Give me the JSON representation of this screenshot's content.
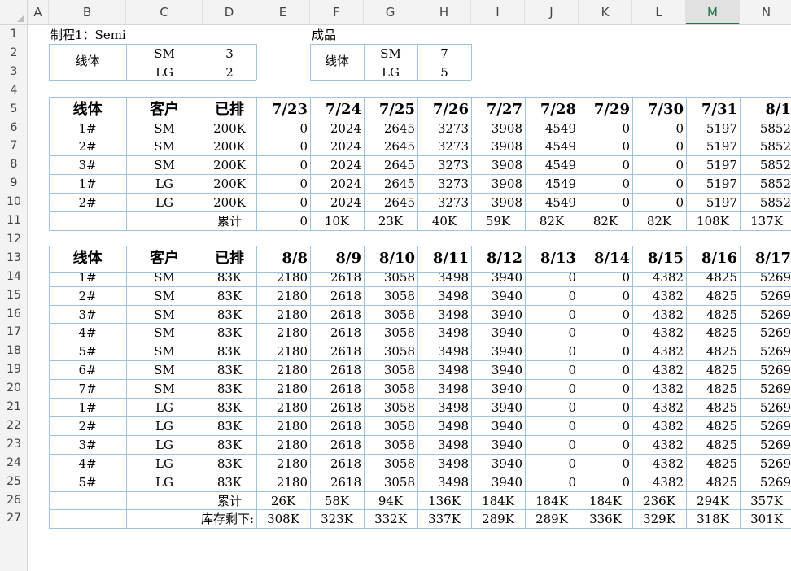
{
  "columns": [
    "A",
    "B",
    "C",
    "D",
    "E",
    "F",
    "G",
    "H",
    "I",
    "J",
    "K",
    "L",
    "M",
    "N"
  ],
  "rows": [
    "1",
    "2",
    "3",
    "4",
    "5",
    "6",
    "7",
    "8",
    "9",
    "10",
    "11",
    "12",
    "13",
    "14",
    "15",
    "16",
    "17",
    "18",
    "19",
    "20",
    "21",
    "22",
    "23",
    "24",
    "25",
    "26",
    "27"
  ],
  "top": {
    "process_label": "制程1：Semi",
    "finished_label": "成品",
    "line_label": "线体",
    "sm": "SM",
    "lg": "LG",
    "semi_sm": "3",
    "semi_lg": "2",
    "fin_sm": "7",
    "fin_lg": "5"
  },
  "table1": {
    "headers": [
      "线体",
      "客户",
      "已排",
      "7/23",
      "7/24",
      "7/25",
      "7/26",
      "7/27",
      "7/28",
      "7/29",
      "7/30",
      "7/31",
      "8/1"
    ],
    "rows": [
      [
        "1#",
        "SM",
        "200K",
        "0",
        "2024",
        "2645",
        "3273",
        "3908",
        "4549",
        "0",
        "0",
        "5197",
        "5852"
      ],
      [
        "2#",
        "SM",
        "200K",
        "0",
        "2024",
        "2645",
        "3273",
        "3908",
        "4549",
        "0",
        "0",
        "5197",
        "5852"
      ],
      [
        "3#",
        "SM",
        "200K",
        "0",
        "2024",
        "2645",
        "3273",
        "3908",
        "4549",
        "0",
        "0",
        "5197",
        "5852"
      ],
      [
        "1#",
        "LG",
        "200K",
        "0",
        "2024",
        "2645",
        "3273",
        "3908",
        "4549",
        "0",
        "0",
        "5197",
        "5852"
      ],
      [
        "2#",
        "LG",
        "200K",
        "0",
        "2024",
        "2645",
        "3273",
        "3908",
        "4549",
        "0",
        "0",
        "5197",
        "5852"
      ]
    ],
    "cumulative_label": "累计",
    "cumulative": [
      "0",
      "10K",
      "23K",
      "40K",
      "59K",
      "82K",
      "82K",
      "82K",
      "108K",
      "137K"
    ]
  },
  "table2": {
    "headers": [
      "线体",
      "客户",
      "已排",
      "8/8",
      "8/9",
      "8/10",
      "8/11",
      "8/12",
      "8/13",
      "8/14",
      "8/15",
      "8/16",
      "8/17"
    ],
    "rows": [
      [
        "1#",
        "SM",
        "83K",
        "2180",
        "2618",
        "3058",
        "3498",
        "3940",
        "0",
        "0",
        "4382",
        "4825",
        "5269"
      ],
      [
        "2#",
        "SM",
        "83K",
        "2180",
        "2618",
        "3058",
        "3498",
        "3940",
        "0",
        "0",
        "4382",
        "4825",
        "5269"
      ],
      [
        "3#",
        "SM",
        "83K",
        "2180",
        "2618",
        "3058",
        "3498",
        "3940",
        "0",
        "0",
        "4382",
        "4825",
        "5269"
      ],
      [
        "4#",
        "SM",
        "83K",
        "2180",
        "2618",
        "3058",
        "3498",
        "3940",
        "0",
        "0",
        "4382",
        "4825",
        "5269"
      ],
      [
        "5#",
        "SM",
        "83K",
        "2180",
        "2618",
        "3058",
        "3498",
        "3940",
        "0",
        "0",
        "4382",
        "4825",
        "5269"
      ],
      [
        "6#",
        "SM",
        "83K",
        "2180",
        "2618",
        "3058",
        "3498",
        "3940",
        "0",
        "0",
        "4382",
        "4825",
        "5269"
      ],
      [
        "7#",
        "SM",
        "83K",
        "2180",
        "2618",
        "3058",
        "3498",
        "3940",
        "0",
        "0",
        "4382",
        "4825",
        "5269"
      ],
      [
        "1#",
        "LG",
        "83K",
        "2180",
        "2618",
        "3058",
        "3498",
        "3940",
        "0",
        "0",
        "4382",
        "4825",
        "5269"
      ],
      [
        "2#",
        "LG",
        "83K",
        "2180",
        "2618",
        "3058",
        "3498",
        "3940",
        "0",
        "0",
        "4382",
        "4825",
        "5269"
      ],
      [
        "3#",
        "LG",
        "83K",
        "2180",
        "2618",
        "3058",
        "3498",
        "3940",
        "0",
        "0",
        "4382",
        "4825",
        "5269"
      ],
      [
        "4#",
        "LG",
        "83K",
        "2180",
        "2618",
        "3058",
        "3498",
        "3940",
        "0",
        "0",
        "4382",
        "4825",
        "5269"
      ],
      [
        "5#",
        "LG",
        "83K",
        "2180",
        "2618",
        "3058",
        "3498",
        "3940",
        "0",
        "0",
        "4382",
        "4825",
        "5269"
      ]
    ],
    "cumulative_label": "累计",
    "cumulative": [
      "26K",
      "58K",
      "94K",
      "136K",
      "184K",
      "184K",
      "184K",
      "236K",
      "294K",
      "357K"
    ],
    "remaining_label": "库存剩下:",
    "remaining": [
      "308K",
      "323K",
      "332K",
      "337K",
      "289K",
      "289K",
      "336K",
      "329K",
      "318K",
      "301K"
    ]
  },
  "selected_column": "M",
  "colors": {
    "border": "#9dc3e6",
    "selected": "#217346",
    "header_bg": "#f3f3f3"
  }
}
